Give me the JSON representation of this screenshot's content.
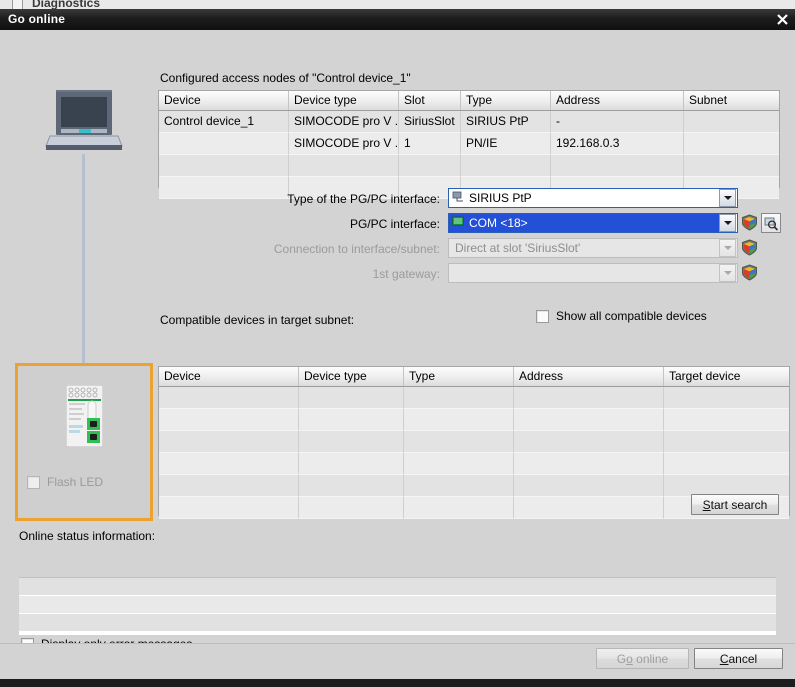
{
  "background": {
    "behind_title": "Diagnostics"
  },
  "window": {
    "title": "Go online",
    "close_icon": "close-icon"
  },
  "nodes_section": {
    "caption": "Configured access nodes of \"Control device_1\"",
    "columns": [
      "Device",
      "Device type",
      "Slot",
      "Type",
      "Address",
      "Subnet"
    ],
    "rows": [
      [
        "Control device_1",
        "SIMOCODE pro V ...",
        "SiriusSlot",
        "SIRIUS PtP",
        "-",
        ""
      ],
      [
        "",
        "SIMOCODE pro V ...",
        "1",
        "PN/IE",
        "192.168.0.3",
        ""
      ],
      [
        "",
        "",
        "",
        "",
        "",
        ""
      ],
      [
        "",
        "",
        "",
        "",
        "",
        ""
      ]
    ]
  },
  "form": {
    "type_label": "Type of the PG/PC interface:",
    "type_value": "SIRIUS PtP",
    "type_icon": "pgpc-interface-icon",
    "interface_label": "PG/PC interface:",
    "interface_value": "COM <18>",
    "interface_icon": "com-port-icon",
    "connection_label": "Connection to interface/subnet:",
    "connection_value": "Direct at slot 'SiriusSlot'",
    "gateway_label": "1st gateway:",
    "gateway_value": "",
    "shield_icon": "properties-shield-icon",
    "search_icon": "search-interface-icon"
  },
  "device_panel": {
    "flash_led_label": "Flash LED",
    "flash_led_checked": false,
    "device_icon": "simocode-device-icon",
    "pc_icon": "pg-pc-laptop-icon"
  },
  "devices_section": {
    "caption": "Compatible devices in target subnet:",
    "show_all_label": "Show all compatible devices",
    "show_all_checked": false,
    "columns": [
      "Device",
      "Device type",
      "Type",
      "Address",
      "Target device"
    ],
    "rows": [
      [
        "",
        "",
        "",
        "",
        ""
      ],
      [
        "",
        "",
        "",
        "",
        ""
      ],
      [
        "",
        "",
        "",
        "",
        ""
      ],
      [
        "",
        "",
        "",
        "",
        ""
      ],
      [
        "",
        "",
        "",
        "",
        ""
      ],
      [
        "",
        "",
        "",
        "",
        ""
      ]
    ],
    "start_search_label": "Start search",
    "start_search_accesskey": "S"
  },
  "status_section": {
    "caption": "Online status information:",
    "rows": [
      "",
      "",
      ""
    ],
    "error_only_label": "Display only error messages",
    "error_only_checked": false
  },
  "footer": {
    "go_online_label": "Go online",
    "go_online_accesskey": "o",
    "go_online_disabled": true,
    "cancel_label": "Cancel",
    "cancel_accesskey": "C"
  },
  "colors": {
    "accent_orange": "#eda12e",
    "selection_blue": "#2450d8",
    "focus_blue": "#2a5fb4",
    "dialog_bg": "#d3d3d3",
    "titlebar": "#1c1c1c"
  }
}
